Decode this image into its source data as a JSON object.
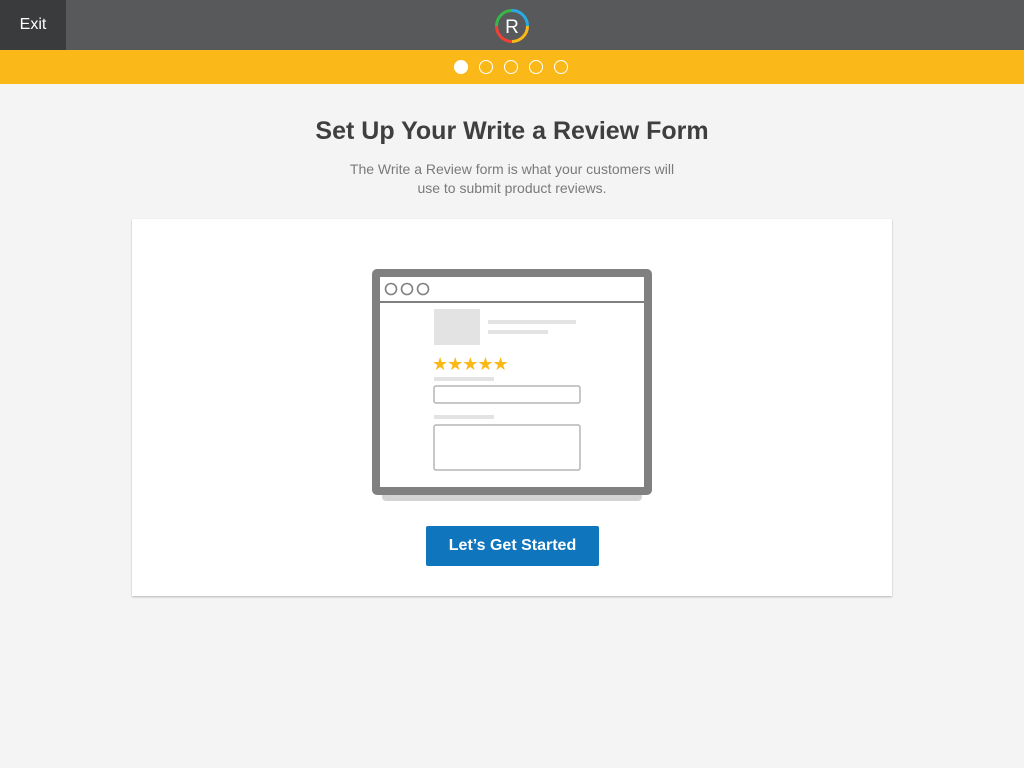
{
  "header": {
    "exit_label": "Exit",
    "logo_letter": "R"
  },
  "progress": {
    "total_steps": 5,
    "current_step": 1
  },
  "main": {
    "title": "Set Up Your Write a Review Form",
    "subtitle": "The Write a Review form is what your customers will use to submit product reviews."
  },
  "illustration": {
    "stars": "★★★★★",
    "star_color": "#fbb819"
  },
  "cta_label": "Let’s Get Started",
  "colors": {
    "topbar": "#58595b",
    "progress_band": "#fbb819",
    "primary_button": "#0f75bc"
  },
  "icons": {
    "logo": "ratings-logo-icon",
    "progress": "step-dot-icon"
  }
}
